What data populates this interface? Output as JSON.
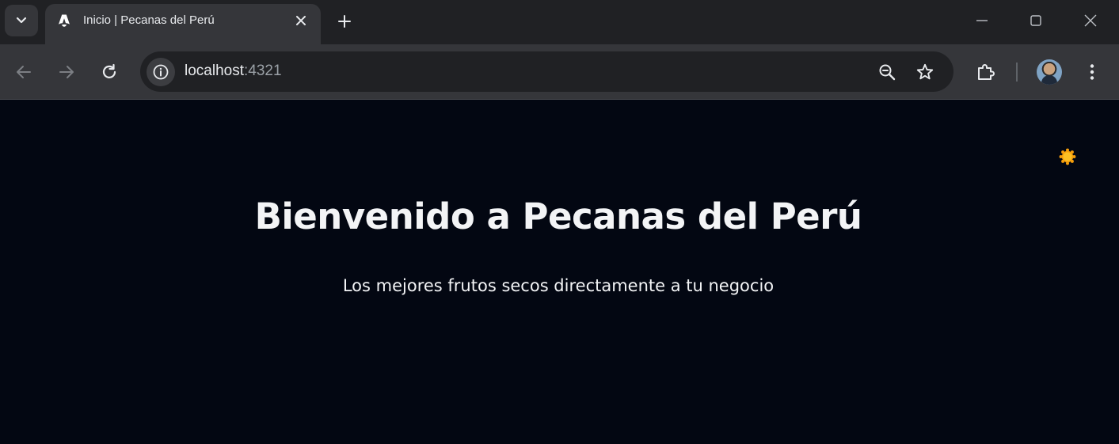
{
  "browser": {
    "tab": {
      "title": "Inicio | Pecanas del Perú",
      "favicon": "astro-logo-icon"
    },
    "address": {
      "host": "localhost",
      "port": ":4321"
    },
    "icons": {
      "tab_search": "chevron-down-icon",
      "close_tab": "close-icon",
      "new_tab": "plus-icon",
      "back": "back-arrow-icon",
      "forward": "forward-arrow-icon",
      "reload": "reload-icon",
      "site_info": "info-icon",
      "zoom": "zoom-out-icon",
      "bookmark": "star-icon",
      "extensions": "puzzle-icon",
      "menu": "kebab-menu-icon"
    },
    "colors": {
      "chrome_dark": "#202124",
      "chrome_mid": "#35363a"
    }
  },
  "page": {
    "heading": "Bienvenido a Pecanas del Perú",
    "subheading": "Los mejores frutos secos directamente a tu negocio",
    "theme_toggle": "sun-icon",
    "colors": {
      "background": "#030712",
      "text": "#f3f4f6",
      "sun": "#f59e0b"
    }
  }
}
